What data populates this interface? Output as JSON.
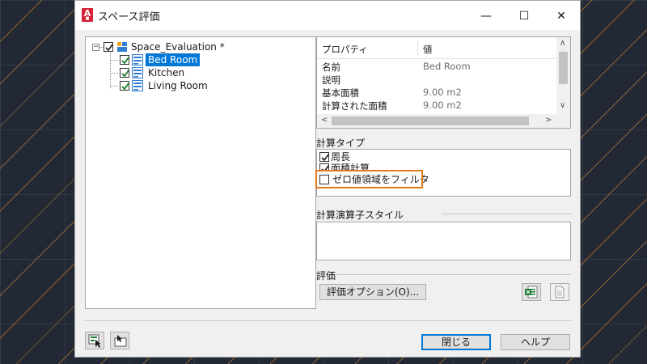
{
  "window": {
    "title": "スペース評価",
    "minimize": "—",
    "maximize": "☐",
    "close": "✕",
    "app_icon_letter": "A"
  },
  "tree": {
    "root": {
      "label": "Space_Evaluation *",
      "checked": true,
      "expander": "−"
    },
    "children": [
      {
        "label": "Bed Room",
        "checked": true,
        "selected": true
      },
      {
        "label": "Kitchen",
        "checked": true,
        "selected": false
      },
      {
        "label": "Living Room",
        "checked": true,
        "selected": false
      }
    ]
  },
  "properties": {
    "headers": [
      "プロパティ",
      "値"
    ],
    "rows": [
      {
        "name": "名前",
        "value": "Bed Room"
      },
      {
        "name": "説明",
        "value": ""
      },
      {
        "name": "基本面積",
        "value": "9.00 m2"
      },
      {
        "name": "計算された面積",
        "value": "9.00 m2"
      }
    ],
    "scroll_up": "∧",
    "scroll_down": "∨",
    "scroll_left": "<",
    "scroll_right": ">"
  },
  "calc_type": {
    "label": "計算タイプ",
    "items": [
      {
        "label": "周長",
        "checked": true
      },
      {
        "label": "面積計算",
        "checked": true
      },
      {
        "label": "ゼロ値領域をフィルタ",
        "checked": false,
        "highlighted": true
      }
    ],
    "highlight_color": "#e07b16"
  },
  "operator_style": {
    "label": "計算演算子スタイル"
  },
  "evaluation": {
    "label": "評価",
    "options_button": "評価オプション(O)..."
  },
  "footer": {
    "close_button": "閉じる",
    "help_button": "ヘルプ"
  },
  "colors": {
    "selection": "#0078d7",
    "accent_red": "#d6253a",
    "background": "#222934",
    "stripe": "#de8c3c"
  }
}
